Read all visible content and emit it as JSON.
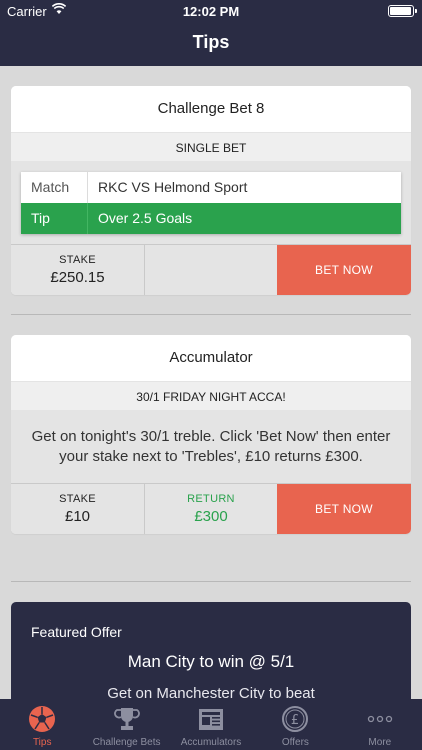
{
  "status": {
    "carrier": "Carrier",
    "time": "12:02 PM"
  },
  "nav": {
    "title": "Tips"
  },
  "challenge_card": {
    "title": "Challenge Bet 8",
    "bet_type": "SINGLE BET",
    "match_label": "Match",
    "match_value": "RKC VS Helmond Sport",
    "tip_label": "Tip",
    "tip_value": "Over 2.5 Goals",
    "stake_label": "STAKE",
    "stake_value": "£250.15",
    "bet_now": "BET NOW"
  },
  "accumulator_card": {
    "title": "Accumulator",
    "subtitle": "30/1 FRIDAY NIGHT ACCA!",
    "description": "Get on tonight's 30/1 treble. Click 'Bet Now' then enter your stake next to 'Trebles', £10 returns £300.",
    "stake_label": "STAKE",
    "stake_value": "£10",
    "return_label": "RETURN",
    "return_value": "£300",
    "bet_now": "BET NOW"
  },
  "featured_offer": {
    "label": "Featured Offer",
    "title": "Man City to win @ 5/1",
    "teaser": "Get on Manchester City to beat"
  },
  "tabs": [
    {
      "label": "Tips",
      "icon": "football-icon",
      "active": true
    },
    {
      "label": "Challenge Bets",
      "icon": "trophy-icon",
      "active": false
    },
    {
      "label": "Accumulators",
      "icon": "newspaper-icon",
      "active": false
    },
    {
      "label": "Offers",
      "icon": "pound-coin-icon",
      "active": false
    },
    {
      "label": "More",
      "icon": "more-dots-icon",
      "active": false
    }
  ],
  "colors": {
    "navy": "#2a2c44",
    "tip_green": "#2aa24d",
    "bet_now_red": "#e8644f",
    "background": "#d9d9d9"
  }
}
